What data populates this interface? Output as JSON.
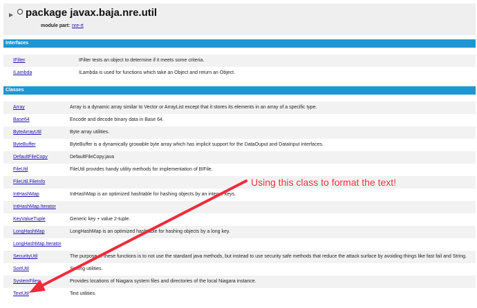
{
  "header": {
    "title": "package javax.baja.nre.util",
    "module_label": "module part:",
    "module_link": "nre-rt"
  },
  "interfaces": {
    "heading": "Interfaces",
    "rows": [
      {
        "name": "IFilter",
        "desc": "IFilter tests an object to determine if it meets some criteria."
      },
      {
        "name": "ILambda",
        "desc": "ILambda is used for functions which take an Object and return an Object."
      }
    ]
  },
  "classes": {
    "heading": "Classes",
    "rows": [
      {
        "name": "Array",
        "desc": "Array is a dynamic array similar to Vector or ArrayList except that it stores its elements in an array of a specific type."
      },
      {
        "name": "Base64",
        "desc": "Encode and decode binary data in Base 64."
      },
      {
        "name": "ByteArrayUtil",
        "desc": "Byte array utilities."
      },
      {
        "name": "ByteBuffer",
        "desc": "ByteBuffer is a dynamically growable byte array which has implicit support for the DataOuput and DataInput interfaces."
      },
      {
        "name": "DefaultFileCopy",
        "desc": "DefaultFileCopy.java"
      },
      {
        "name": "FileUtil",
        "desc": "FileUtil provides handy utility methods for implementation of BIFile."
      },
      {
        "name": "FileUtil.FileInfo",
        "desc": ""
      },
      {
        "name": "IntHashMap",
        "desc": "IntHashMap is an optimized hashtable for hashing objects by an integer keys."
      },
      {
        "name": "IntHashMap.Iterator",
        "desc": ""
      },
      {
        "name": "KeyValueTuple",
        "desc": "Generic key + value 2-tuple."
      },
      {
        "name": "LongHashMap",
        "desc": "LongHashMap is an optimized hashtable for hashing objects by a long key."
      },
      {
        "name": "LongHashMap.Iterator",
        "desc": ""
      },
      {
        "name": "SecurityUtil",
        "desc": "The purpose of these functions is to not use the standard java methods, but instead to use security safe methods that reduce the attack surface by avoiding things like fast fail and String."
      },
      {
        "name": "SortUtil",
        "desc": "Sorting utilities."
      },
      {
        "name": "SystemFiles",
        "desc": "Provides locations of Niagara system files and directories of the local Niagara instance."
      },
      {
        "name": "TextUtil",
        "desc": "Text utilities."
      }
    ]
  },
  "annotation": {
    "text": "Using this class to format the text!",
    "color": "#ee2b3b"
  },
  "colors": {
    "section_bar": "#1e96d2",
    "row_alt": "#f2f2f2",
    "link": "#1a0dab"
  }
}
